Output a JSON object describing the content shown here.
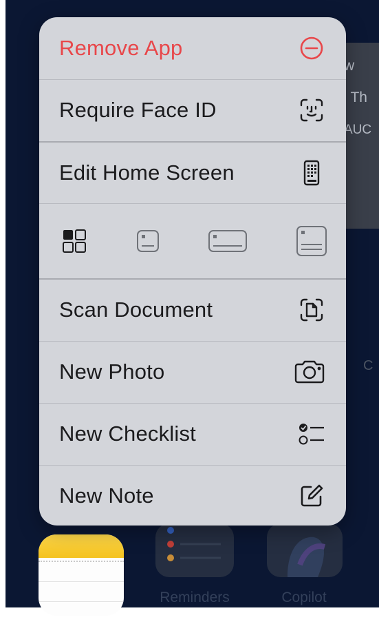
{
  "background": {
    "widget_lines": [
      "w",
      "' Th",
      "AUC"
    ],
    "side_label": "C",
    "dock": {
      "reminders_label": "Reminders",
      "copilot_label": "Copilot"
    }
  },
  "menu": {
    "remove_app": {
      "label": "Remove App",
      "icon": "minus-circle-icon",
      "color": "#e8474a"
    },
    "require_face_id": {
      "label": "Require Face ID",
      "icon": "face-id-icon"
    },
    "edit_home_screen": {
      "label": "Edit Home Screen",
      "icon": "phone-apps-icon"
    },
    "widget_sizes": [
      "app-grid-icon",
      "small-widget-icon",
      "medium-widget-icon",
      "large-widget-icon"
    ],
    "scan_document": {
      "label": "Scan Document",
      "icon": "doc-scan-icon"
    },
    "new_photo": {
      "label": "New Photo",
      "icon": "camera-icon"
    },
    "new_checklist": {
      "label": "New Checklist",
      "icon": "checklist-icon"
    },
    "new_note": {
      "label": "New Note",
      "icon": "compose-icon"
    }
  },
  "colors": {
    "menu_bg": "#d3d5da",
    "wallpaper": "#0b1733",
    "destructive": "#e8474a"
  }
}
